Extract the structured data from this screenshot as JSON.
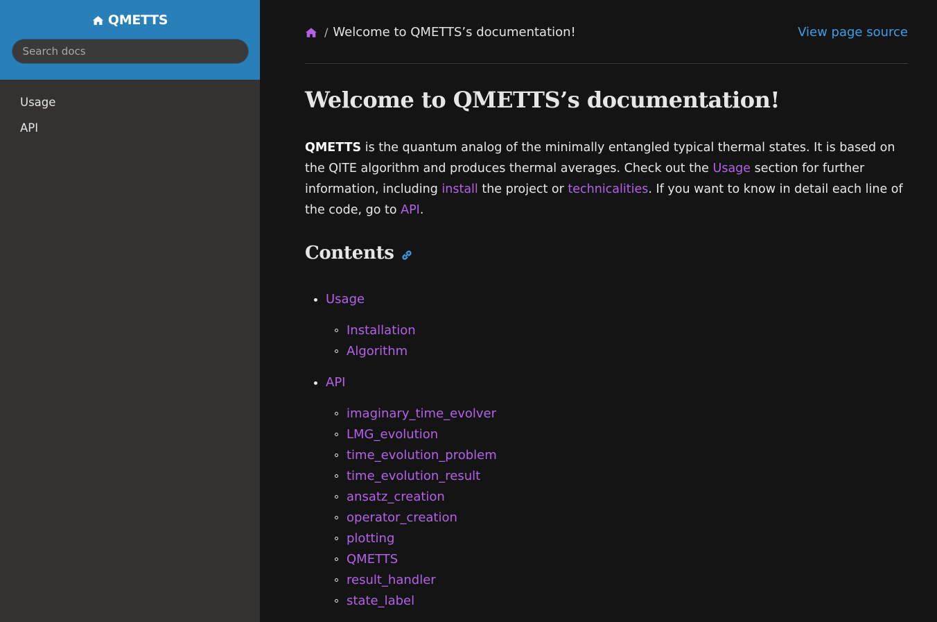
{
  "sidebar": {
    "project_name": "QMETTS",
    "search_placeholder": "Search docs",
    "nav": [
      {
        "label": "Usage"
      },
      {
        "label": "API"
      }
    ]
  },
  "breadcrumb": {
    "current": "Welcome to QMETTS’s documentation!",
    "separator": "/",
    "view_source": "View page source"
  },
  "page": {
    "title": "Welcome to QMETTS’s documentation!",
    "intro": {
      "bold": "QMETTS",
      "t1": " is the quantum analog of the minimally entangled typical thermal states. It is based on the QITE algorithm and produces thermal averages. Check out the ",
      "link_usage": "Usage",
      "t2": " section for further information, including ",
      "link_install": "install",
      "t3": " the project or ",
      "link_tech": "technicalities",
      "t4": ". If you want to know in detail each line of the code, go to ",
      "link_api": "API",
      "t5": "."
    },
    "contents_heading": "Contents",
    "toc": [
      {
        "label": "Usage",
        "children": [
          {
            "label": "Installation"
          },
          {
            "label": "Algorithm"
          }
        ]
      },
      {
        "label": "API",
        "children": [
          {
            "label": "imaginary_time_evolver"
          },
          {
            "label": "LMG_evolution"
          },
          {
            "label": "time_evolution_problem"
          },
          {
            "label": "time_evolution_result"
          },
          {
            "label": "ansatz_creation"
          },
          {
            "label": "operator_creation"
          },
          {
            "label": "plotting"
          },
          {
            "label": "QMETTS"
          },
          {
            "label": "result_handler"
          },
          {
            "label": "state_label"
          }
        ]
      }
    ]
  },
  "icons": {
    "home": "home-icon",
    "permalink": "link-icon"
  },
  "colors": {
    "sidebar_header": "#2980b9",
    "sidebar_bg": "#343131",
    "main_bg": "#141414",
    "link": "#b362e8",
    "view_source": "#3b9fe8"
  }
}
